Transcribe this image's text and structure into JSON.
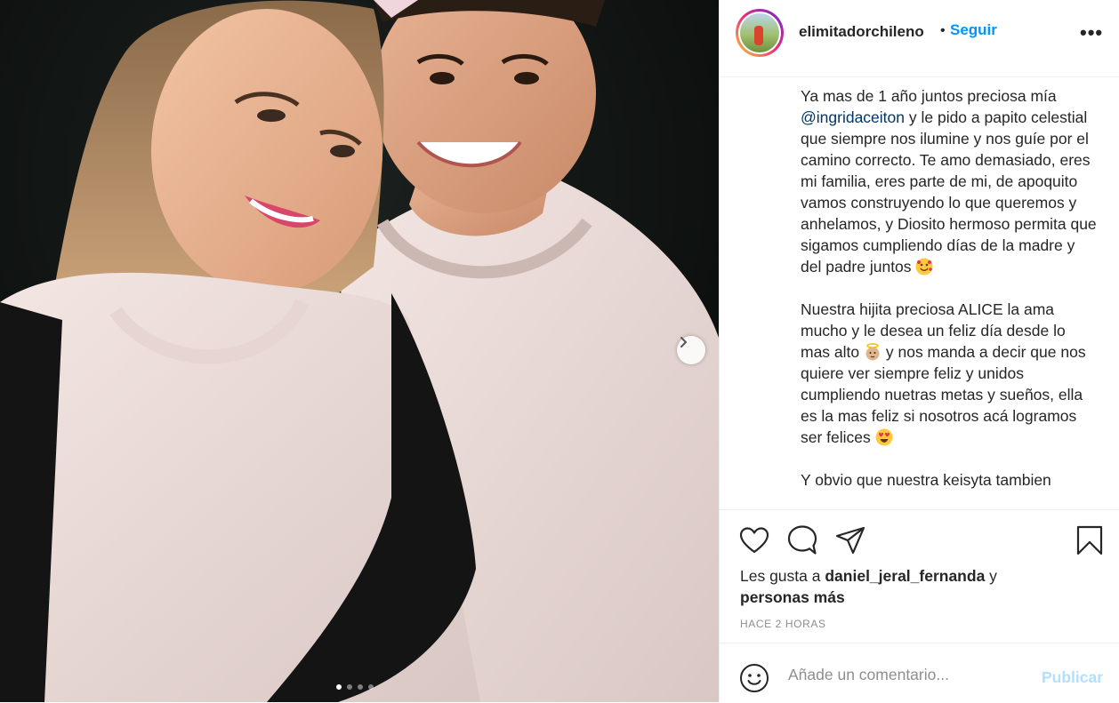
{
  "post": {
    "username": "elimitadorchileno",
    "separator": "•",
    "follow_label": "Seguir",
    "more_label": "•••",
    "caption": {
      "p1_before": "Ya mas de 1 año juntos preciosa mía ",
      "mention": "@ingridaceiton",
      "p1_after": " y le pido a papito celestial que siempre nos ilumine y nos guíe por el camino correcto. Te amo demasiado, eres mi familia, eres parte de mi, de apoquito vamos construyendo lo que queremos y anhelamos, y Diosito hermoso permita que sigamos cumpliendo días de la madre y del padre juntos ",
      "p2_a": "Nuestra hijita preciosa ALICE la ama mucho y le desea un feliz día desde lo mas alto ",
      "p2_b": " y nos manda a decir que nos quiere ver siempre feliz y unidos cumpliendo nuetras metas y sueños, ella es la mas feliz si nosotros acá logramos ser felices ",
      "p3": "Y obvio que nuestra keisyta tambien"
    },
    "likes": {
      "prefix": "Les gusta a ",
      "user": "daniel_jeral_fernanda",
      "middle": " y",
      "others": "personas más"
    },
    "time": "HACE 2 HORAS",
    "comment": {
      "placeholder": "Añade un comentario...",
      "publish_label": "Publicar"
    },
    "carousel": {
      "slide_count": 4,
      "active_index": 0
    },
    "colors": {
      "follow": "#0095f6",
      "mention": "#00376b",
      "publish_disabled": "#b2dffc"
    }
  }
}
